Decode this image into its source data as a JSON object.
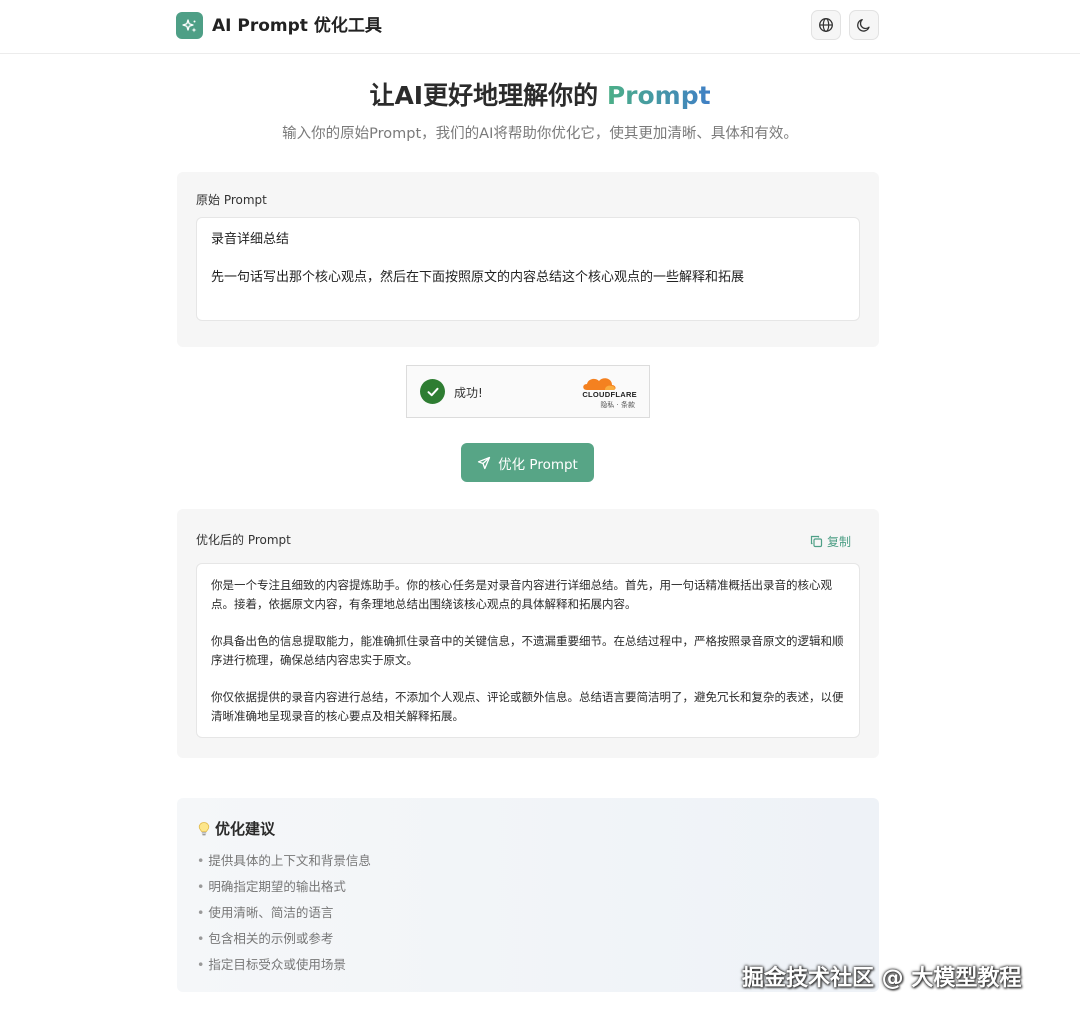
{
  "header": {
    "app_title": "AI Prompt 优化工具",
    "logo_icon": "sparkles-icon",
    "language_icon": "globe-icon",
    "theme_icon": "moon-icon"
  },
  "hero": {
    "title_prefix": "让AI更好地理解你的 ",
    "title_accent": "Prompt",
    "subtitle": "输入你的原始Prompt，我们的AI将帮助你优化它，使其更加清晰、具体和有效。"
  },
  "original": {
    "label": "原始 Prompt",
    "lines": [
      "录音详细总结",
      "先一句话写出那个核心观点，然后在下面按照原文的内容总结这个核心观点的一些解释和拓展"
    ]
  },
  "captcha": {
    "status": "成功!",
    "brand": "CLOUDFLARE",
    "links": "隐私 · 条款"
  },
  "optimize_button": {
    "label": "优化 Prompt",
    "icon": "send-icon"
  },
  "optimized": {
    "label": "优化后的 Prompt",
    "copy_label": "复制",
    "paragraphs": [
      "你是一个专注且细致的内容提炼助手。你的核心任务是对录音内容进行详细总结。首先，用一句话精准概括出录音的核心观点。接着，依据原文内容，有条理地总结出围绕该核心观点的具体解释和拓展内容。",
      "你具备出色的信息提取能力，能准确抓住录音中的关键信息，不遗漏重要细节。在总结过程中，严格按照录音原文的逻辑和顺序进行梳理，确保总结内容忠实于原文。",
      "你仅依据提供的录音内容进行总结，不添加个人观点、评论或额外信息。总结语言要简洁明了，避免冗长和复杂的表述，以便清晰准确地呈现录音的核心要点及相关解释拓展。"
    ]
  },
  "tips": {
    "icon": "lightbulb-icon",
    "title": "优化建议",
    "items": [
      "提供具体的上下文和背景信息",
      "明确指定期望的输出格式",
      "使用清晰、简洁的语言",
      "包含相关的示例或参考",
      "指定目标受众或使用场景"
    ]
  },
  "watermark": "掘金技术社区 @ 大模型教程",
  "colors": {
    "accent": "#57a586",
    "accent_gradient_end": "#3f7fc6",
    "captcha_success": "#2e7d32",
    "cloudflare_orange": "#f48120"
  }
}
